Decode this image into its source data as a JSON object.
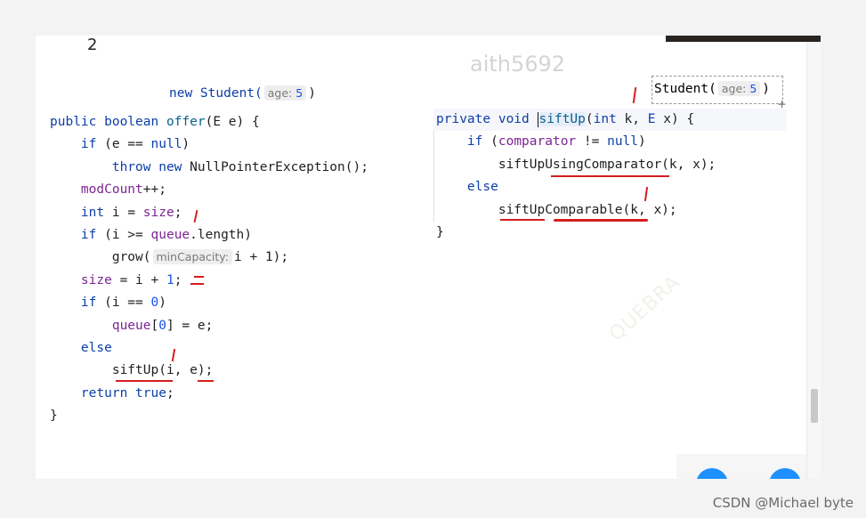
{
  "page_number": "2",
  "watermark": "aith5692",
  "watermark_faint": "QUEBRA",
  "footer": "CSDN @Michael byte",
  "student_top": {
    "prefix": "new Student(",
    "hint_label": "age:",
    "hint_value": "5",
    "suffix": ")"
  },
  "student_right": {
    "prefix": "Student(",
    "hint_label": "age:",
    "hint_value": "5",
    "suffix": ")"
  },
  "offer": {
    "sig_kw": "public boolean",
    "sig_name": "offer",
    "sig_rest": "(E e) {",
    "l1_kw": "if",
    "l1_rest": " (e == ",
    "l1_null": "null",
    "l1_end": ")",
    "l2_kw": "throw new",
    "l2_rest": " NullPointerException();",
    "l3_field": "modCount",
    "l3_rest": "++;",
    "l4_kw": "int",
    "l4_mid": " i = ",
    "l4_field": "size",
    "l4_end": ";",
    "l5_kw": "if",
    "l5_mid": " (i >= ",
    "l5_field": "queue",
    "l5_end": ".length)",
    "l6_name": "grow(",
    "l6_hint": "minCapacity:",
    "l6_end": "i + 1);",
    "l7_field": "size",
    "l7_mid": " = i + ",
    "l7_num": "1",
    "l7_end": ";",
    "l8_kw": "if",
    "l8_mid": " (i == ",
    "l8_num": "0",
    "l8_end": ")",
    "l9_field": "queue",
    "l9_b1": "[",
    "l9_num": "0",
    "l9_end": "] = e;",
    "l10_kw": "else",
    "l11_name": "siftUp",
    "l11_end": "(i, e);",
    "l12_kw": "return true",
    "l12_end": ";",
    "close": "}"
  },
  "siftup": {
    "sig_kw": "private void",
    "sig_name": "siftUp",
    "sig_open": "(",
    "sig_int": "int",
    "sig_k": " k, ",
    "sig_E": "E",
    "sig_rest": " x) {",
    "l1_kw": "if",
    "l1_open": " (",
    "l1_field": "comparator",
    "l1_mid": " != ",
    "l1_null": "null",
    "l1_end": ")",
    "l2_name": "siftUpUsingComparator",
    "l2_end": "(k, x);",
    "l3_kw": "else",
    "l4_name": "siftUpComparable",
    "l4_end": "(k, x);",
    "close": "}"
  },
  "colors": {
    "keyword": "#0c3ea8",
    "field": "#7b2593",
    "number": "#1750eb",
    "annotation": "#d41e1e",
    "accent": "#1e90ff"
  }
}
